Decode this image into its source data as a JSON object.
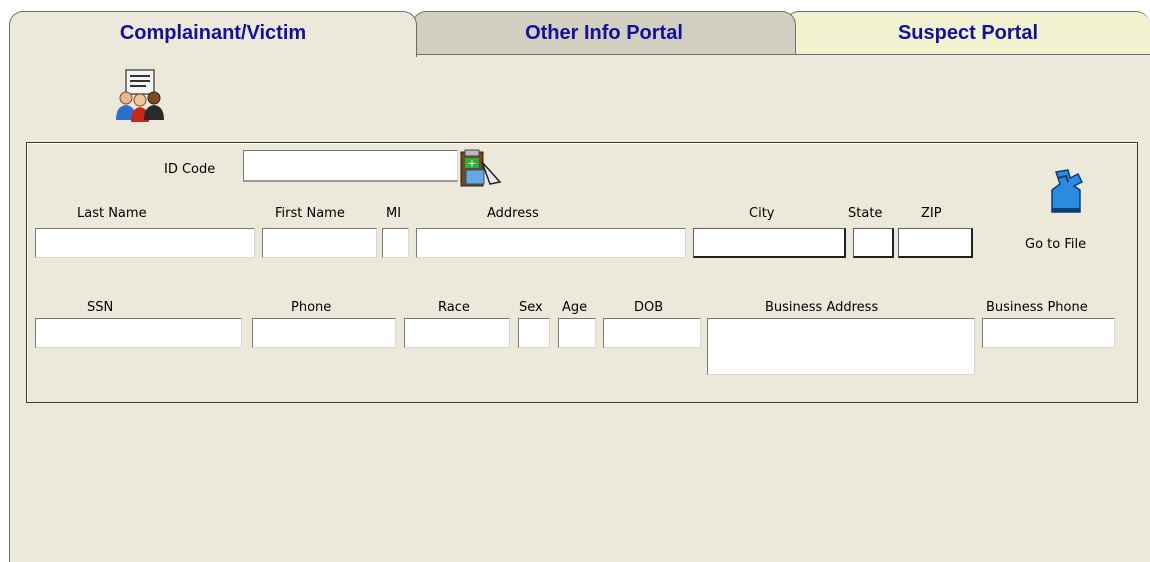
{
  "tabs": [
    {
      "label": "Complainant/Victim",
      "active": true
    },
    {
      "label": "Other Info Portal",
      "active": false
    },
    {
      "label": "Suspect Portal",
      "active": false
    }
  ],
  "icons": {
    "people": "people-report-icon",
    "lookup": "clipboard-lookup-icon",
    "go_to_file": "blue-hand-file-icon"
  },
  "form": {
    "id_code": {
      "label": "ID Code",
      "value": ""
    },
    "last_name": {
      "label": "Last Name",
      "value": ""
    },
    "first_name": {
      "label": "First Name",
      "value": ""
    },
    "mi": {
      "label": "MI",
      "value": ""
    },
    "address": {
      "label": "Address",
      "value": ""
    },
    "city": {
      "label": "City",
      "value": ""
    },
    "state": {
      "label": "State",
      "value": ""
    },
    "zip": {
      "label": "ZIP",
      "value": ""
    },
    "go_to_file": {
      "label": "Go to File"
    },
    "ssn": {
      "label": "SSN",
      "value": ""
    },
    "phone": {
      "label": "Phone",
      "value": ""
    },
    "race": {
      "label": "Race",
      "value": ""
    },
    "sex": {
      "label": "Sex",
      "value": ""
    },
    "age": {
      "label": "Age",
      "value": ""
    },
    "dob": {
      "label": "DOB",
      "value": ""
    },
    "business_address": {
      "label": "Business Address",
      "value": ""
    },
    "business_phone": {
      "label": "Business Phone",
      "value": ""
    }
  },
  "colors": {
    "tab_text": "#11119a",
    "panel_bg": "#ece8da",
    "tab_inactive": "#d3cfc0",
    "tab_suspect": "#f3f2d0"
  }
}
